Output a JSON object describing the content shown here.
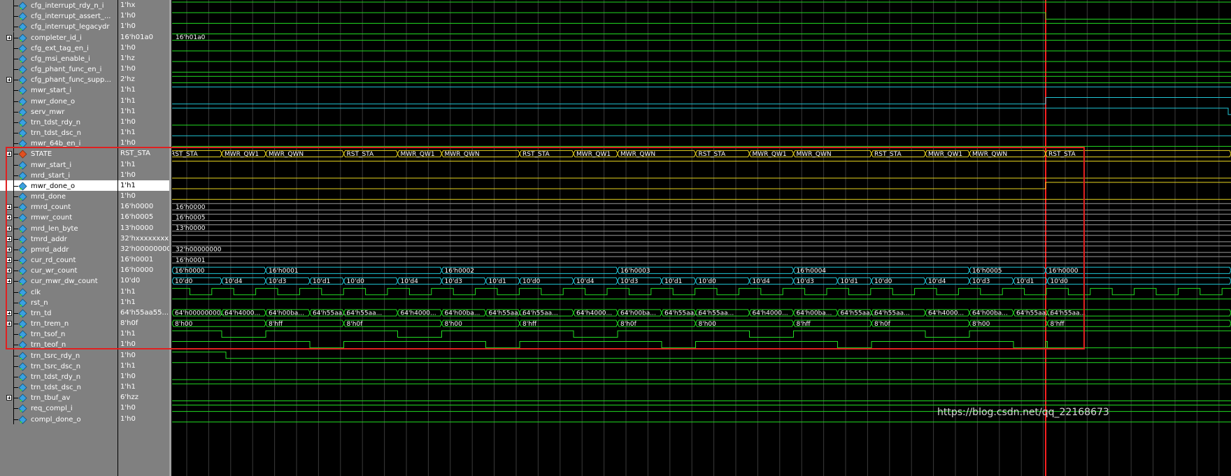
{
  "window": {
    "title": "Waveform"
  },
  "colors": {
    "panel_bg": "#808080",
    "wave_bg": "#000000",
    "grid": "#3a3a3a",
    "signal_green": "#22dd22",
    "signal_cyan": "#21c6d6",
    "signal_yellow": "#e8d51f",
    "cursor": "#ff2020",
    "highlight_box": "#e02020"
  },
  "signals": [
    {
      "name": "cfg_interrupt_rdy_n_i",
      "value": "1'hx",
      "bus": false,
      "icon": "diamond-icon"
    },
    {
      "name": "cfg_interrupt_assert_...",
      "value": "1'h0",
      "bus": false,
      "icon": "diamond-icon"
    },
    {
      "name": "cfg_interrupt_legacydr",
      "value": "1'h0",
      "bus": false,
      "icon": "diamond-icon"
    },
    {
      "name": "completer_id_i",
      "value": "16'h01a0",
      "bus": true,
      "icon": "diamond-icon",
      "wave_label": "16'h01a0"
    },
    {
      "name": "cfg_ext_tag_en_i",
      "value": "1'h0",
      "bus": false,
      "icon": "diamond-icon"
    },
    {
      "name": "cfg_msi_enable_i",
      "value": "1'hz",
      "bus": false,
      "icon": "diamond-icon"
    },
    {
      "name": "cfg_phant_func_en_i",
      "value": "1'h0",
      "bus": false,
      "icon": "diamond-icon"
    },
    {
      "name": "cfg_phant_func_supp...",
      "value": "2'hz",
      "bus": true,
      "icon": "diamond-icon"
    },
    {
      "name": "mwr_start_i",
      "value": "1'h1",
      "bus": false,
      "icon": "diamond-icon"
    },
    {
      "name": "mwr_done_o",
      "value": "1'h1",
      "bus": false,
      "icon": "diamond-icon"
    },
    {
      "name": "serv_mwr",
      "value": "1'h1",
      "bus": false,
      "icon": "diamond-icon"
    },
    {
      "name": "trn_tdst_rdy_n",
      "value": "1'h0",
      "bus": false,
      "icon": "diamond-icon"
    },
    {
      "name": "trn_tdst_dsc_n",
      "value": "1'h1",
      "bus": false,
      "icon": "diamond-icon"
    },
    {
      "name": "mwr_64b_en_i",
      "value": "1'h0",
      "bus": false,
      "icon": "diamond-icon"
    },
    {
      "name": "STATE",
      "value": "RST_STA",
      "bus": true,
      "icon": "state-icon",
      "wave_segments": [
        "RST_STA",
        "MWR_QW1",
        "MWR_QWN",
        "RST_STA",
        "MWR_QW1",
        "MWR_QWN",
        "RST_STA",
        "MWR_QW1",
        "MWR_QWN",
        "RST_STA",
        "MWR_QW1",
        "MWR_QWN",
        "RST_STA",
        "MWR_QW1",
        "MWR_QWN",
        "RST_STA"
      ]
    },
    {
      "name": "mwr_start_i",
      "value": "1'h1",
      "bus": false,
      "icon": "diamond-icon"
    },
    {
      "name": "mrd_start_i",
      "value": "1'h0",
      "bus": false,
      "icon": "diamond-icon"
    },
    {
      "name": "mwr_done_o",
      "value": "1'h1",
      "bus": false,
      "icon": "diamond-icon",
      "selected": true
    },
    {
      "name": "mrd_done",
      "value": "1'h0",
      "bus": false,
      "icon": "diamond-icon"
    },
    {
      "name": "rmrd_count",
      "value": "16'h0000",
      "bus": true,
      "icon": "diamond-icon",
      "wave_label": "16'h0000"
    },
    {
      "name": "rmwr_count",
      "value": "16'h0005",
      "bus": true,
      "icon": "diamond-icon",
      "wave_label": "16'h0005"
    },
    {
      "name": "mrd_len_byte",
      "value": "13'h0000",
      "bus": true,
      "icon": "diamond-icon",
      "wave_label": "13'h0000"
    },
    {
      "name": "tmrd_addr",
      "value": "32'hxxxxxxxx",
      "bus": true,
      "icon": "diamond-icon"
    },
    {
      "name": "pmrd_addr",
      "value": "32'h00000000",
      "bus": true,
      "icon": "diamond-icon",
      "wave_label": "32'h00000000"
    },
    {
      "name": "cur_rd_count",
      "value": "16'h0001",
      "bus": true,
      "icon": "diamond-icon",
      "wave_label": "16'h0001"
    },
    {
      "name": "cur_wr_count",
      "value": "16'h0000",
      "bus": true,
      "icon": "diamond-icon",
      "wave_segments": [
        "16'h0000",
        "16'h0001",
        "16'h0002",
        "16'h0003",
        "16'h0004",
        "16'h0005",
        "16'h0000"
      ]
    },
    {
      "name": "cur_mwr_dw_count",
      "value": "10'd0",
      "bus": true,
      "icon": "diamond-icon",
      "wave_segments": [
        "10'd0",
        "10'd4",
        "10'd3",
        "10'd1",
        "10'd0",
        "10'd4",
        "10'd3",
        "10'd1",
        "10'd0",
        "10'd4",
        "10'd3",
        "10'd1",
        "10'd0",
        "10'd4",
        "10'd3",
        "10'd1",
        "10'd0",
        "10'd4",
        "10'd3",
        "10'd1",
        "10'd0"
      ]
    },
    {
      "name": "clk",
      "value": "1'h1",
      "bus": false,
      "icon": "diamond-icon"
    },
    {
      "name": "rst_n",
      "value": "1'h1",
      "bus": false,
      "icon": "diamond-icon"
    },
    {
      "name": "trn_td",
      "value": "64'h55aa55...",
      "bus": true,
      "icon": "diamond-icon",
      "wave_segments": [
        "64'h00000000...",
        "64'h4000...",
        "64'h00ba...",
        "64'h55aa...",
        "64'h55aa...",
        "64'h4000...",
        "64'h00ba...",
        "64'h55aa...",
        "64'h55aa...",
        "64'h4000...",
        "64'h00ba...",
        "64'h55aa...",
        "64'h55aa...",
        "64'h4000...",
        "64'h00ba...",
        "64'h55aa...",
        "64'h55aa...",
        "64'h4000...",
        "64'h00ba...",
        "64'h55aa...",
        "64'h55aa..."
      ]
    },
    {
      "name": "trn_trem_n",
      "value": "8'h0f",
      "bus": true,
      "icon": "diamond-icon",
      "wave_segments": [
        "8'h00",
        "8'hff",
        "8'h0f",
        "8'h00",
        "8'hff",
        "8'h0f",
        "8'h00",
        "8'hff",
        "8'h0f",
        "8'h00",
        "8'hff",
        "8'h0f",
        "8'h00",
        "8'hff",
        "8'h0f"
      ]
    },
    {
      "name": "trn_tsof_n",
      "value": "1'h1",
      "bus": false,
      "icon": "diamond-icon"
    },
    {
      "name": "trn_teof_n",
      "value": "1'h0",
      "bus": false,
      "icon": "diamond-icon"
    },
    {
      "name": "trn_tsrc_rdy_n",
      "value": "1'h0",
      "bus": false,
      "icon": "diamond-icon"
    },
    {
      "name": "trn_tsrc_dsc_n",
      "value": "1'h1",
      "bus": false,
      "icon": "diamond-icon"
    },
    {
      "name": "trn_tdst_rdy_n",
      "value": "1'h0",
      "bus": false,
      "icon": "diamond-icon"
    },
    {
      "name": "trn_tdst_dsc_n",
      "value": "1'h1",
      "bus": false,
      "icon": "diamond-icon"
    },
    {
      "name": "trn_tbuf_av",
      "value": "6'hzz",
      "bus": true,
      "icon": "diamond-icon"
    },
    {
      "name": "req_compl_i",
      "value": "1'h0",
      "bus": false,
      "icon": "diamond-icon"
    },
    {
      "name": "compl_done_o",
      "value": "1'h0",
      "bus": false,
      "icon": "diamond-icon"
    }
  ],
  "watermark": "https://blog.csdn.net/qq_22168673"
}
